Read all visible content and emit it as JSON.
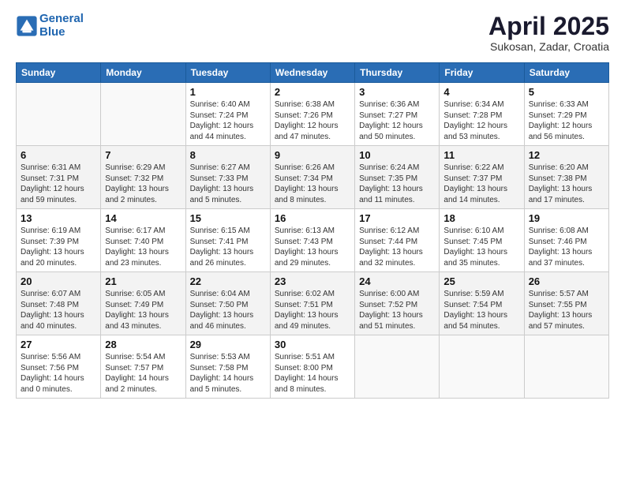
{
  "header": {
    "logo_line1": "General",
    "logo_line2": "Blue",
    "month": "April 2025",
    "location": "Sukosan, Zadar, Croatia"
  },
  "days_of_week": [
    "Sunday",
    "Monday",
    "Tuesday",
    "Wednesday",
    "Thursday",
    "Friday",
    "Saturday"
  ],
  "weeks": [
    {
      "row_class": "row-odd",
      "days": [
        {
          "num": "",
          "empty": true
        },
        {
          "num": "",
          "empty": true
        },
        {
          "num": "1",
          "info": "Sunrise: 6:40 AM\nSunset: 7:24 PM\nDaylight: 12 hours\nand 44 minutes."
        },
        {
          "num": "2",
          "info": "Sunrise: 6:38 AM\nSunset: 7:26 PM\nDaylight: 12 hours\nand 47 minutes."
        },
        {
          "num": "3",
          "info": "Sunrise: 6:36 AM\nSunset: 7:27 PM\nDaylight: 12 hours\nand 50 minutes."
        },
        {
          "num": "4",
          "info": "Sunrise: 6:34 AM\nSunset: 7:28 PM\nDaylight: 12 hours\nand 53 minutes."
        },
        {
          "num": "5",
          "info": "Sunrise: 6:33 AM\nSunset: 7:29 PM\nDaylight: 12 hours\nand 56 minutes."
        }
      ]
    },
    {
      "row_class": "row-even",
      "days": [
        {
          "num": "6",
          "info": "Sunrise: 6:31 AM\nSunset: 7:31 PM\nDaylight: 12 hours\nand 59 minutes."
        },
        {
          "num": "7",
          "info": "Sunrise: 6:29 AM\nSunset: 7:32 PM\nDaylight: 13 hours\nand 2 minutes."
        },
        {
          "num": "8",
          "info": "Sunrise: 6:27 AM\nSunset: 7:33 PM\nDaylight: 13 hours\nand 5 minutes."
        },
        {
          "num": "9",
          "info": "Sunrise: 6:26 AM\nSunset: 7:34 PM\nDaylight: 13 hours\nand 8 minutes."
        },
        {
          "num": "10",
          "info": "Sunrise: 6:24 AM\nSunset: 7:35 PM\nDaylight: 13 hours\nand 11 minutes."
        },
        {
          "num": "11",
          "info": "Sunrise: 6:22 AM\nSunset: 7:37 PM\nDaylight: 13 hours\nand 14 minutes."
        },
        {
          "num": "12",
          "info": "Sunrise: 6:20 AM\nSunset: 7:38 PM\nDaylight: 13 hours\nand 17 minutes."
        }
      ]
    },
    {
      "row_class": "row-odd",
      "days": [
        {
          "num": "13",
          "info": "Sunrise: 6:19 AM\nSunset: 7:39 PM\nDaylight: 13 hours\nand 20 minutes."
        },
        {
          "num": "14",
          "info": "Sunrise: 6:17 AM\nSunset: 7:40 PM\nDaylight: 13 hours\nand 23 minutes."
        },
        {
          "num": "15",
          "info": "Sunrise: 6:15 AM\nSunset: 7:41 PM\nDaylight: 13 hours\nand 26 minutes."
        },
        {
          "num": "16",
          "info": "Sunrise: 6:13 AM\nSunset: 7:43 PM\nDaylight: 13 hours\nand 29 minutes."
        },
        {
          "num": "17",
          "info": "Sunrise: 6:12 AM\nSunset: 7:44 PM\nDaylight: 13 hours\nand 32 minutes."
        },
        {
          "num": "18",
          "info": "Sunrise: 6:10 AM\nSunset: 7:45 PM\nDaylight: 13 hours\nand 35 minutes."
        },
        {
          "num": "19",
          "info": "Sunrise: 6:08 AM\nSunset: 7:46 PM\nDaylight: 13 hours\nand 37 minutes."
        }
      ]
    },
    {
      "row_class": "row-even",
      "days": [
        {
          "num": "20",
          "info": "Sunrise: 6:07 AM\nSunset: 7:48 PM\nDaylight: 13 hours\nand 40 minutes."
        },
        {
          "num": "21",
          "info": "Sunrise: 6:05 AM\nSunset: 7:49 PM\nDaylight: 13 hours\nand 43 minutes."
        },
        {
          "num": "22",
          "info": "Sunrise: 6:04 AM\nSunset: 7:50 PM\nDaylight: 13 hours\nand 46 minutes."
        },
        {
          "num": "23",
          "info": "Sunrise: 6:02 AM\nSunset: 7:51 PM\nDaylight: 13 hours\nand 49 minutes."
        },
        {
          "num": "24",
          "info": "Sunrise: 6:00 AM\nSunset: 7:52 PM\nDaylight: 13 hours\nand 51 minutes."
        },
        {
          "num": "25",
          "info": "Sunrise: 5:59 AM\nSunset: 7:54 PM\nDaylight: 13 hours\nand 54 minutes."
        },
        {
          "num": "26",
          "info": "Sunrise: 5:57 AM\nSunset: 7:55 PM\nDaylight: 13 hours\nand 57 minutes."
        }
      ]
    },
    {
      "row_class": "row-odd",
      "days": [
        {
          "num": "27",
          "info": "Sunrise: 5:56 AM\nSunset: 7:56 PM\nDaylight: 14 hours\nand 0 minutes."
        },
        {
          "num": "28",
          "info": "Sunrise: 5:54 AM\nSunset: 7:57 PM\nDaylight: 14 hours\nand 2 minutes."
        },
        {
          "num": "29",
          "info": "Sunrise: 5:53 AM\nSunset: 7:58 PM\nDaylight: 14 hours\nand 5 minutes."
        },
        {
          "num": "30",
          "info": "Sunrise: 5:51 AM\nSunset: 8:00 PM\nDaylight: 14 hours\nand 8 minutes."
        },
        {
          "num": "",
          "empty": true
        },
        {
          "num": "",
          "empty": true
        },
        {
          "num": "",
          "empty": true
        }
      ]
    }
  ]
}
